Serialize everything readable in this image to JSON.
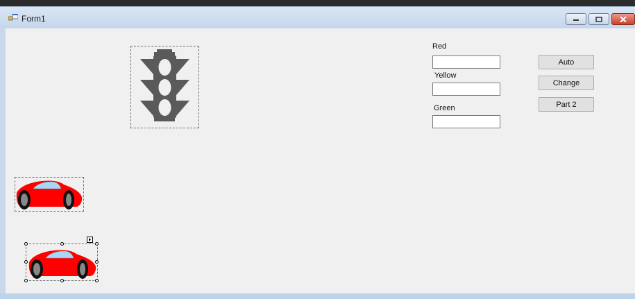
{
  "window": {
    "title": "Form1"
  },
  "labels": {
    "red": "Red",
    "yellow": "Yellow",
    "green": "Green"
  },
  "inputs": {
    "red_value": "",
    "yellow_value": "",
    "green_value": ""
  },
  "buttons": {
    "auto": "Auto",
    "change": "Change",
    "part2": "Part 2"
  },
  "icons": {
    "app": "form-icon",
    "traffic_light": "traffic-light-icon",
    "car": "red-car-icon"
  },
  "colors": {
    "client_bg": "#f0f0f0",
    "car_body": "#ff0000",
    "traffic_light": "#5a5a5a"
  }
}
